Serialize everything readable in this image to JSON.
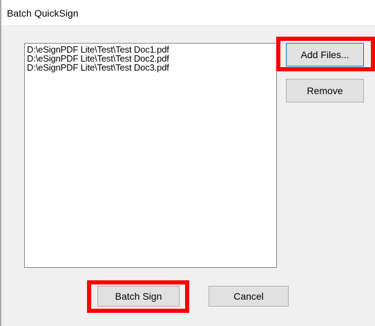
{
  "window": {
    "title": "Batch QuickSign"
  },
  "file_list": {
    "items": [
      "D:\\eSignPDF Lite\\Test\\Test Doc1.pdf",
      "D:\\eSignPDF Lite\\Test\\Test Doc2.pdf",
      "D:\\eSignPDF Lite\\Test\\Test Doc3.pdf"
    ]
  },
  "buttons": {
    "add_files": "Add Files...",
    "remove": "Remove",
    "batch_sign": "Batch Sign",
    "cancel": "Cancel"
  },
  "colors": {
    "dialog_background": "#f0f0f0",
    "button_face": "#e1e1e1",
    "focus_border": "#0078d7",
    "highlight": "#ff0000"
  }
}
